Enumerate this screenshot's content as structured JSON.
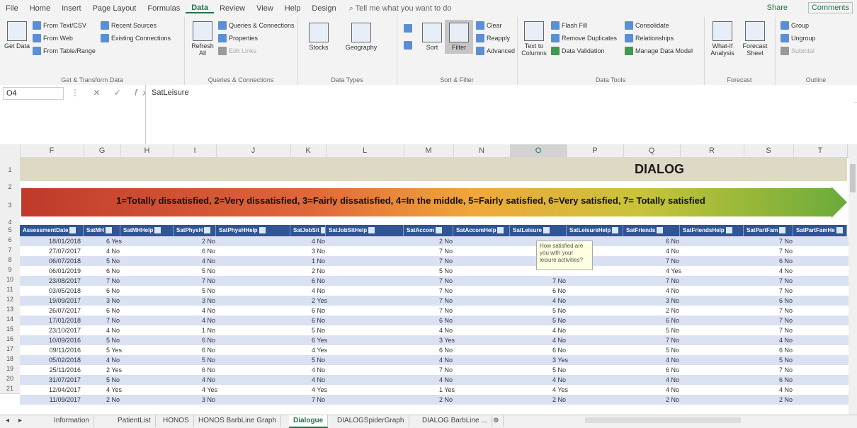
{
  "menu": [
    "File",
    "Home",
    "Insert",
    "Page Layout",
    "Formulas",
    "Data",
    "Review",
    "View",
    "Help",
    "Design"
  ],
  "active_menu": "Data",
  "tellme": "Tell me what you want to do",
  "share": "Share",
  "comments": "Comments",
  "ribbon": {
    "get_transform": {
      "get_data": "Get Data",
      "from_text": "From Text/CSV",
      "from_web": "From Web",
      "from_table": "From Table/Range",
      "recent": "Recent Sources",
      "existing": "Existing Connections",
      "label": "Get & Transform Data"
    },
    "queries": {
      "refresh": "Refresh All",
      "qc": "Queries & Connections",
      "properties": "Properties",
      "edit_links": "Edit Links",
      "label": "Queries & Connections"
    },
    "data_types": {
      "stocks": "Stocks",
      "geography": "Geography",
      "label": "Data Types"
    },
    "sort_filter": {
      "sort": "Sort",
      "filter": "Filter",
      "clear": "Clear",
      "reapply": "Reapply",
      "advanced": "Advanced",
      "label": "Sort & Filter"
    },
    "data_tools": {
      "text_to_columns": "Text to Columns",
      "flash_fill": "Flash Fill",
      "remove_dup": "Remove Duplicates",
      "validation": "Data Validation",
      "consolidate": "Consolidate",
      "relationships": "Relationships",
      "manage_model": "Manage Data Model",
      "label": "Data Tools"
    },
    "forecast": {
      "what_if": "What-If Analysis",
      "sheet": "Forecast Sheet",
      "label": "Forecast"
    },
    "outline": {
      "group": "Group",
      "ungroup": "Ungroup",
      "subtotal": "Subtotal",
      "label": "Outline"
    }
  },
  "namebox": "O4",
  "formula": "SatLeisure",
  "columns": [
    "F",
    "G",
    "H",
    "I",
    "J",
    "K",
    "L",
    "M",
    "N",
    "O",
    "P",
    "Q",
    "R",
    "S",
    "T"
  ],
  "row_numbers": [
    "1",
    "2",
    "3",
    "4",
    "5",
    "6",
    "7",
    "8",
    "9",
    "10",
    "11",
    "12",
    "13",
    "14",
    "15",
    "16",
    "17",
    "18",
    "19",
    "20",
    "21"
  ],
  "title": "DIALOG",
  "scale": "1=Totally dissatisfied,  2=Very dissatisfied,  3=Fairly dissatisfied,  4=In the middle,  5=Fairly satisfied,  6=Very satisfied,  7= Totally satisfied",
  "headers": [
    "AssessmentDate",
    "SatMH",
    "SatMHHelp",
    "SatPhysH",
    "SatPhysHHelp",
    "SatJobSit",
    "SatJobSitHelp",
    "SatAccom",
    "SatAccomHelp",
    "SatLeisure",
    "SatLeisureHelp",
    "SatFriends",
    "SatFriendsHelp",
    "SatPartFam",
    "SatPartFamHe"
  ],
  "rows": [
    [
      "18/01/2018",
      "6 Yes",
      "2 No",
      "4 No",
      "2 No",
      "",
      "",
      "6 No",
      "7 No"
    ],
    [
      "27/07/2017",
      "4 No",
      "6 No",
      "3 No",
      "7 No",
      "",
      "",
      "4 No",
      "7 No"
    ],
    [
      "06/07/2018",
      "5 No",
      "4 No",
      "1 No",
      "7 No",
      "",
      "",
      "7 No",
      "6 No"
    ],
    [
      "06/01/2019",
      "6 No",
      "5 No",
      "2 No",
      "5 No",
      "",
      "",
      "4 Yes",
      "4 No"
    ],
    [
      "23/08/2017",
      "7 No",
      "7 No",
      "6 No",
      "7 No",
      "7 No",
      "",
      "7 No",
      "7 No"
    ],
    [
      "03/05/2018",
      "6 No",
      "5 No",
      "4 No",
      "7 No",
      "6 No",
      "",
      "4 No",
      "7 No"
    ],
    [
      "19/09/2017",
      "3 No",
      "3 No",
      "2 Yes",
      "7 No",
      "4 No",
      "",
      "3 No",
      "6 No"
    ],
    [
      "26/07/2017",
      "6 No",
      "4 No",
      "6 No",
      "7 No",
      "5 No",
      "",
      "2 No",
      "7 No"
    ],
    [
      "17/01/2018",
      "7 No",
      "4 No",
      "6 No",
      "6 No",
      "5 No",
      "",
      "6 No",
      "7 No"
    ],
    [
      "23/10/2017",
      "4 No",
      "1 No",
      "5 No",
      "4 No",
      "4 No",
      "",
      "5 No",
      "7 No"
    ],
    [
      "10/09/2016",
      "5 No",
      "6 No",
      "6 Yes",
      "3 Yes",
      "4 No",
      "",
      "7 No",
      "4 No"
    ],
    [
      "09/11/2016",
      "5 Yes",
      "6 No",
      "4 Yes",
      "6 No",
      "6 No",
      "",
      "5 No",
      "6 No"
    ],
    [
      "05/02/2018",
      "4 No",
      "5 No",
      "5 No",
      "4 No",
      "3 Yes",
      "",
      "4 No",
      "5 No"
    ],
    [
      "25/11/2016",
      "2 Yes",
      "6 No",
      "4 No",
      "7 No",
      "5 No",
      "",
      "6 No",
      "7 No"
    ],
    [
      "31/07/2017",
      "5 No",
      "4 No",
      "4 No",
      "4 No",
      "4 No",
      "",
      "4 No",
      "6 No"
    ],
    [
      "12/04/2017",
      "4 Yes",
      "4 Yes",
      "4 Yes",
      "1 Yes",
      "4 Yes",
      "",
      "4 No",
      "4 No"
    ],
    [
      "11/09/2017",
      "2 No",
      "3 No",
      "7 No",
      "2 No",
      "2 No",
      "",
      "2 No",
      "2 No"
    ]
  ],
  "tooltip": "How satisfied are you with your leisure activities?",
  "tabs": [
    "Information",
    "PatientList",
    "HONOS",
    "HONOS BarbLine Graph",
    "Dialogue",
    "DIALOGSpiderGraph",
    "DIALOG BarbLine ..."
  ],
  "active_tab": "Dialogue",
  "colors": {
    "accent": "#217346",
    "header": "#2f5597",
    "band": "#ddd9c4"
  }
}
